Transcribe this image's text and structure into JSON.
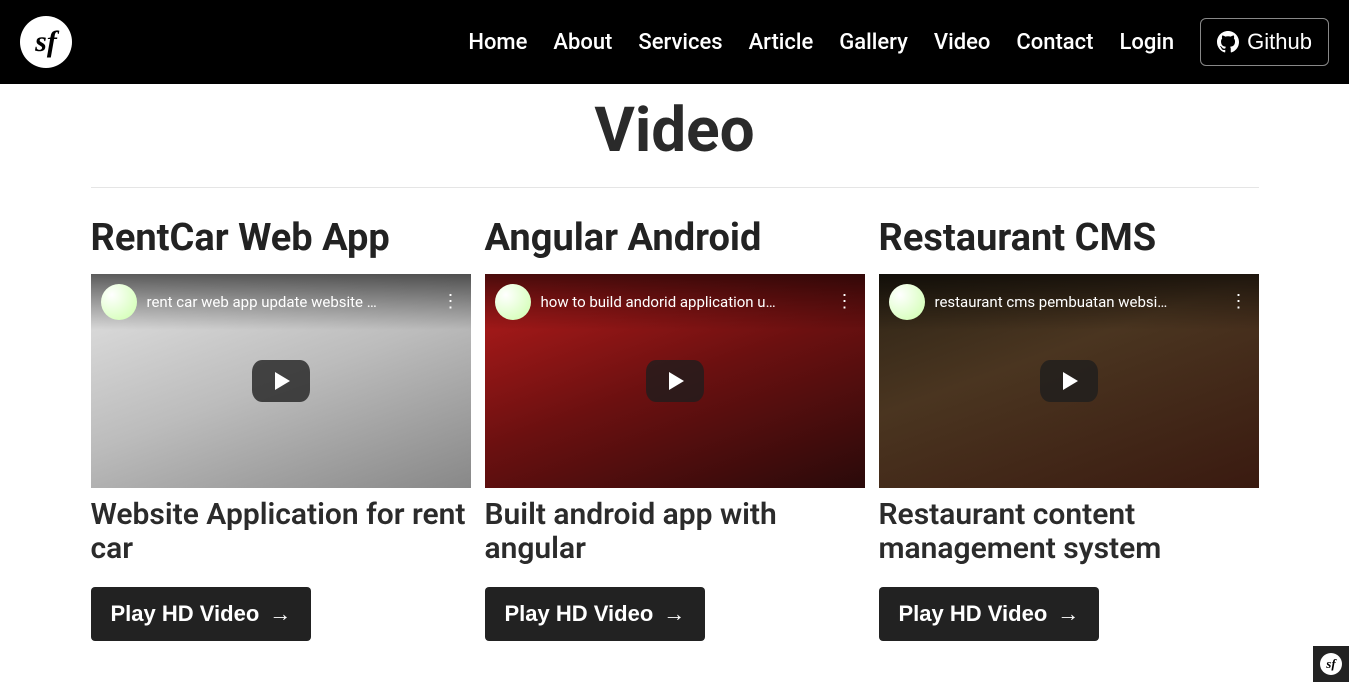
{
  "logo": {
    "text": "sf"
  },
  "nav": {
    "items": [
      {
        "label": "Home"
      },
      {
        "label": "About"
      },
      {
        "label": "Services"
      },
      {
        "label": "Article"
      },
      {
        "label": "Gallery"
      },
      {
        "label": "Video"
      },
      {
        "label": "Contact"
      },
      {
        "label": "Login"
      }
    ],
    "github_label": "Github"
  },
  "page": {
    "title": "Video"
  },
  "videos": [
    {
      "title": "RentCar Web App",
      "thumb_title": "rent car web app update website …",
      "subtitle": "Website Application for rent car",
      "button": "Play HD Video"
    },
    {
      "title": "Angular Android",
      "thumb_title": "how to build andorid application u…",
      "subtitle": "Built android app with angular",
      "button": "Play HD Video"
    },
    {
      "title": "Restaurant CMS",
      "thumb_title": "restaurant cms pembuatan websi…",
      "subtitle": "Restaurant content management system",
      "button": "Play HD Video"
    }
  ],
  "badge": {
    "text": "sf"
  }
}
